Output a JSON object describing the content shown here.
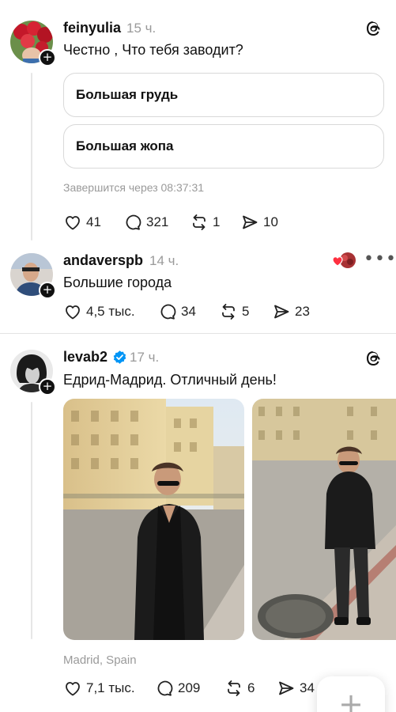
{
  "posts": [
    {
      "username": "feinyulia",
      "time": "15 ч.",
      "text": "Честно , Что тебя заводит?",
      "poll": {
        "options": [
          "Большая грудь",
          "Большая жопа"
        ],
        "ends": "Завершится через 08:37:31"
      },
      "actions": {
        "likes": "41",
        "replies": "321",
        "reposts": "1",
        "shares": "10"
      }
    },
    {
      "username": "andaverspb",
      "time": "14 ч.",
      "text": "Большие города",
      "actions": {
        "likes": "4,5 тыс.",
        "replies": "34",
        "reposts": "5",
        "shares": "23"
      }
    },
    {
      "username": "levab2",
      "verified": true,
      "time": "17 ч.",
      "text": "Едрид-Мадрид. Отличный день!",
      "location": "Madrid, Spain",
      "actions": {
        "likes": "7,1 тыс.",
        "replies": "209",
        "reposts": "6",
        "shares": "34"
      }
    }
  ],
  "fab": {
    "icon": "plus-icon",
    "glyph": "+"
  },
  "colors": {
    "accent_blue": "#0095f6",
    "muted": "#9a9a9a",
    "divider": "#e3e3e3"
  }
}
